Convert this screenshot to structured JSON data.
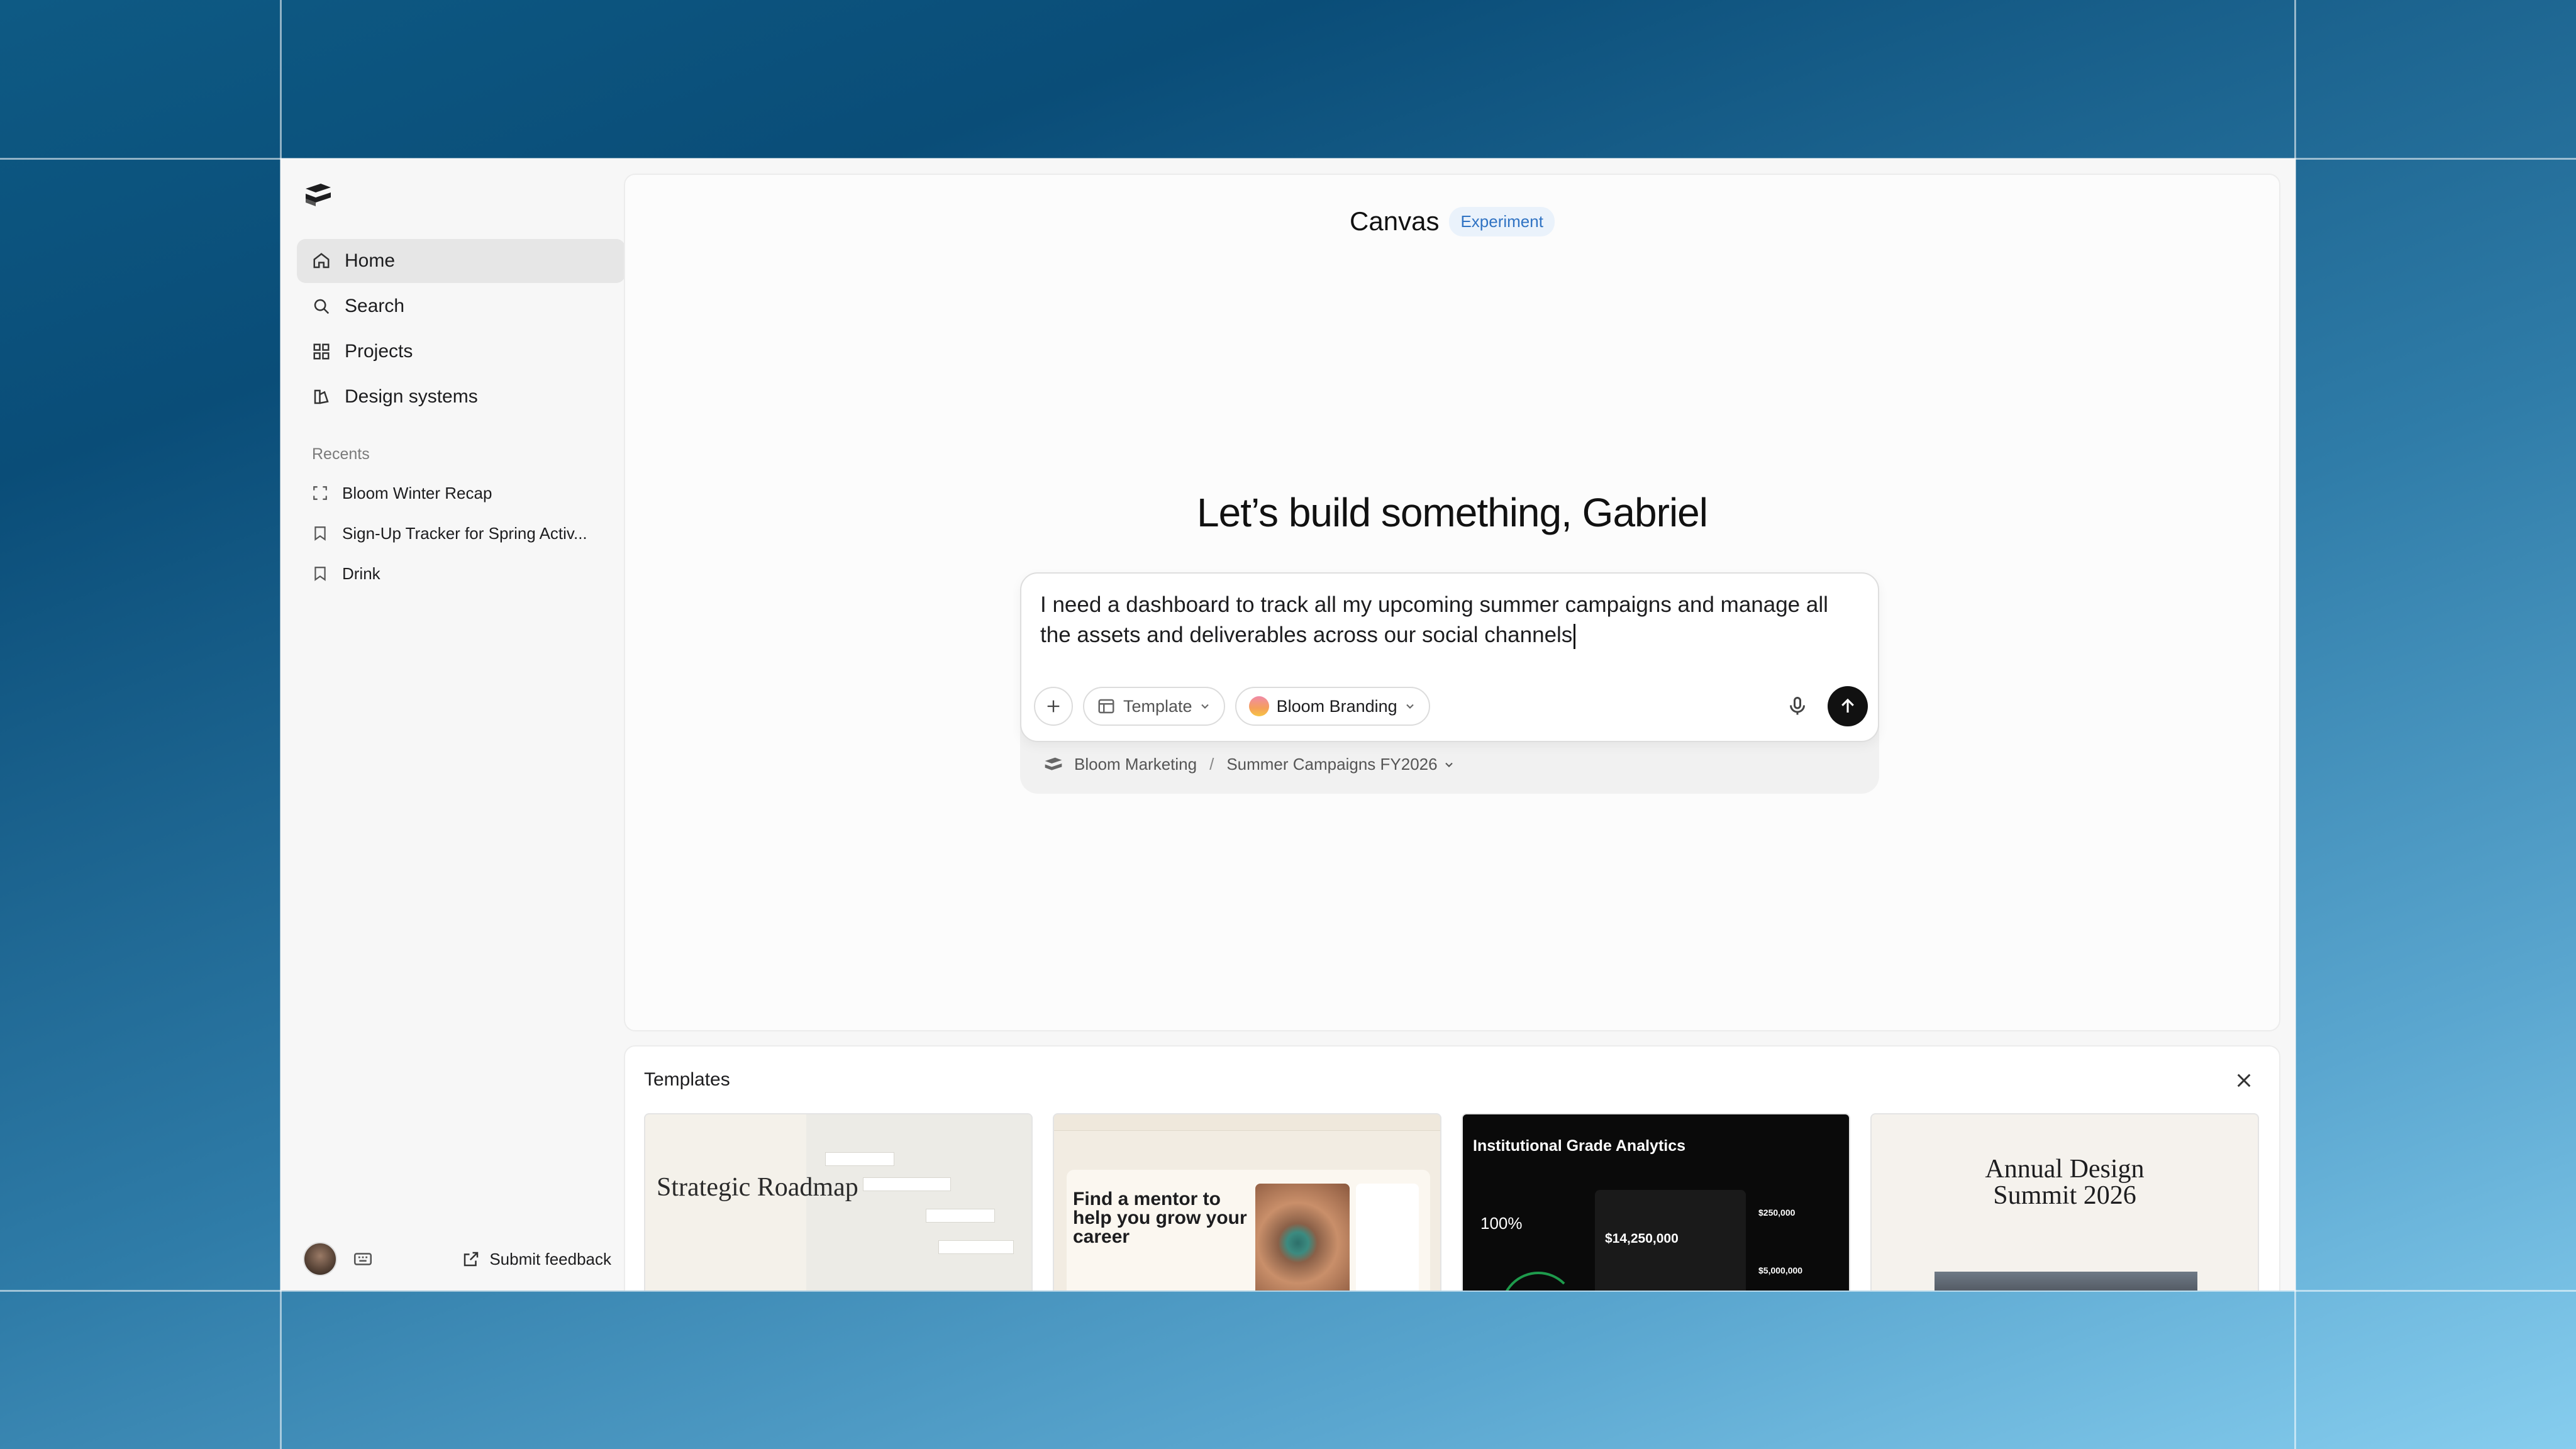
{
  "sidebar": {
    "logo_icon": "stacked-pages-logo",
    "nav": [
      {
        "label": "Home",
        "icon": "home-icon",
        "active": true
      },
      {
        "label": "Search",
        "icon": "search-icon"
      },
      {
        "label": "Projects",
        "icon": "grid-icon"
      },
      {
        "label": "Design systems",
        "icon": "design-system-icon"
      }
    ],
    "recents_label": "Recents",
    "recents": [
      {
        "label": "Bloom Winter Recap",
        "icon": "frame-icon"
      },
      {
        "label": "Sign-Up Tracker for Spring Activ...",
        "icon": "bookmark-icon"
      },
      {
        "label": "Drink",
        "icon": "bookmark-icon"
      }
    ],
    "footer": {
      "feedback_label": "Submit feedback"
    }
  },
  "main": {
    "title": "Canvas",
    "badge": "Experiment",
    "greeting": "Let’s build something, Gabriel",
    "prompt": {
      "text": "I need a dashboard to track all my upcoming summer campaigns and manage all the assets and deliverables across our social channels",
      "template_label": "Template",
      "brand_label": "Bloom Branding"
    },
    "context": {
      "workspace": "Bloom Marketing",
      "separator": "/",
      "project": "Summer Campaigns FY2026"
    }
  },
  "templates": {
    "title": "Templates",
    "items": [
      {
        "title": "Strategic Roadmap"
      },
      {
        "title": "Find a mentor to help you grow your career"
      },
      {
        "title": "Institutional Grade Analytics",
        "stat1": "100%",
        "stat2": "$14,250,000",
        "stat3": "$250,000",
        "stat4": "$5,000,000"
      },
      {
        "title": "Annual Design Summit 2026"
      }
    ]
  },
  "colors": {
    "accent_badge_text": "#3073c3",
    "accent_badge_bg": "#eaf2fb",
    "send_button": "#111111"
  }
}
